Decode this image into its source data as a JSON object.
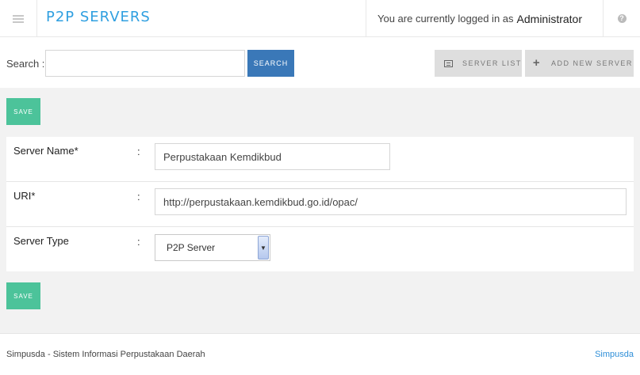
{
  "header": {
    "title": "P2P SERVERS",
    "login_prefix": "You are currently logged in as",
    "user": "Administrator",
    "help_icon": "question-circle-icon",
    "menu_icon": "hamburger-icon"
  },
  "search": {
    "label": "Search :",
    "value": "",
    "placeholder": "",
    "button": "SEARCH"
  },
  "toolbar": {
    "server_list": "SERVER LIST",
    "add_new_server": "ADD NEW SERVER"
  },
  "form": {
    "save_label": "SAVE",
    "fields": [
      {
        "label": "Server Name*",
        "colon": ":",
        "value": "Perpustakaan Kemdikbud"
      },
      {
        "label": "URI*",
        "colon": ":",
        "value": "http://perpustakaan.kemdikbud.go.id/opac/"
      },
      {
        "label": "Server Type",
        "colon": ":",
        "selected": "P2P Server"
      }
    ]
  },
  "footer": {
    "text": "Simpusda - Sistem Informasi Perpustakaan Daerah",
    "link": "Simpusda"
  },
  "colors": {
    "accent": "#2f9fe0",
    "search_button": "#3a78b8",
    "save_button": "#4cc39a",
    "top_buttons": "#dedede",
    "content_bg": "#f2f2f2"
  }
}
